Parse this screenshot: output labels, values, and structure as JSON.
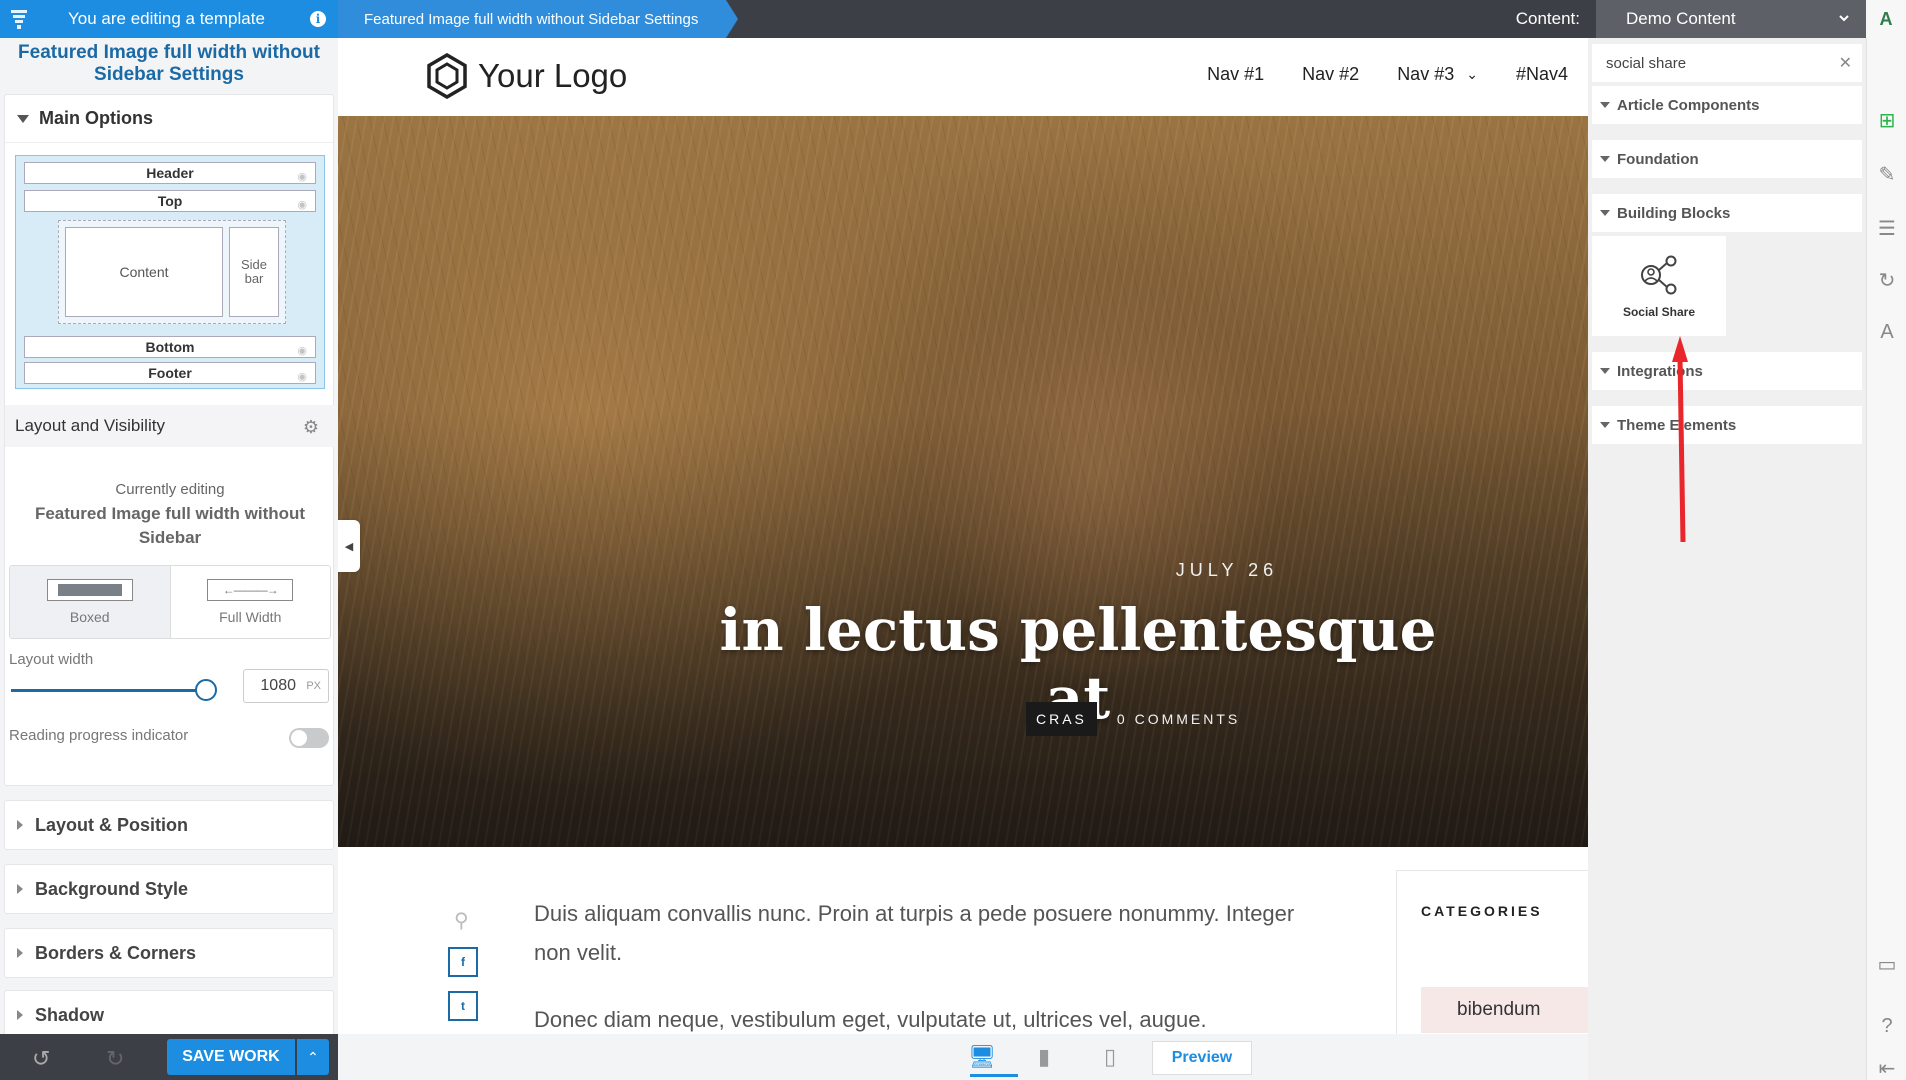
{
  "topbar": {
    "editing_label": "You are editing a template",
    "breadcrumb": "Featured Image full width without Sidebar Settings",
    "content_label": "Content:",
    "content_select": "Demo Content"
  },
  "left_panel": {
    "title": "Featured Image full width without Sidebar Settings",
    "main_options": "Main Options",
    "layout_parts": {
      "header": "Header",
      "top": "Top",
      "content": "Content",
      "sidebar": "Side bar",
      "bottom": "Bottom",
      "footer": "Footer"
    },
    "layout_visibility": "Layout and Visibility",
    "currently_editing_label": "Currently editing",
    "currently_editing_name": "Featured Image full width without Sidebar",
    "width_options": {
      "boxed": "Boxed",
      "full": "Full Width",
      "selected": "Boxed"
    },
    "layout_width_label": "Layout width",
    "layout_width_value": "1080",
    "layout_width_unit": "PX",
    "layout_width_fraction": 0.85,
    "reading_progress_label": "Reading progress indicator",
    "reading_progress_on": false,
    "sections": [
      "Layout & Position",
      "Background Style",
      "Borders & Corners",
      "Shadow"
    ]
  },
  "bottombar": {
    "save_label": "SAVE WORK"
  },
  "site": {
    "logo_text": "Your Logo",
    "nav": [
      "Nav #1",
      "Nav #2",
      "Nav #3",
      "#Nav4"
    ],
    "hero": {
      "date": "JULY 26",
      "title": "in lectus pellentesque at",
      "category": "CRAS",
      "comments": "0 COMMENTS"
    },
    "article": {
      "p1": "Duis aliquam convallis nunc. Proin at turpis a pede posuere nonummy. Integer non velit.",
      "p2": "Donec diam neque, vestibulum eget, vulputate ut, ultrices vel, augue."
    },
    "share_buttons": [
      "f",
      "t"
    ],
    "widget": {
      "title": "CATEGORIES",
      "tag": "bibendum"
    }
  },
  "device_bar": {
    "preview_label": "Preview",
    "active_device": "desktop"
  },
  "add_panel": {
    "search_value": "social share",
    "sections": [
      "Article Components",
      "Foundation",
      "Building Blocks",
      "Integrations",
      "Theme Elements"
    ],
    "tile_label": "Social Share"
  },
  "rail": {
    "top_letter": "A"
  },
  "colors": {
    "accent": "#1c8de0",
    "topbar": "#3c3f45",
    "title_blue": "#1b6aa5",
    "arrow_red": "#e8262b",
    "rail_green": "#2db14b"
  }
}
